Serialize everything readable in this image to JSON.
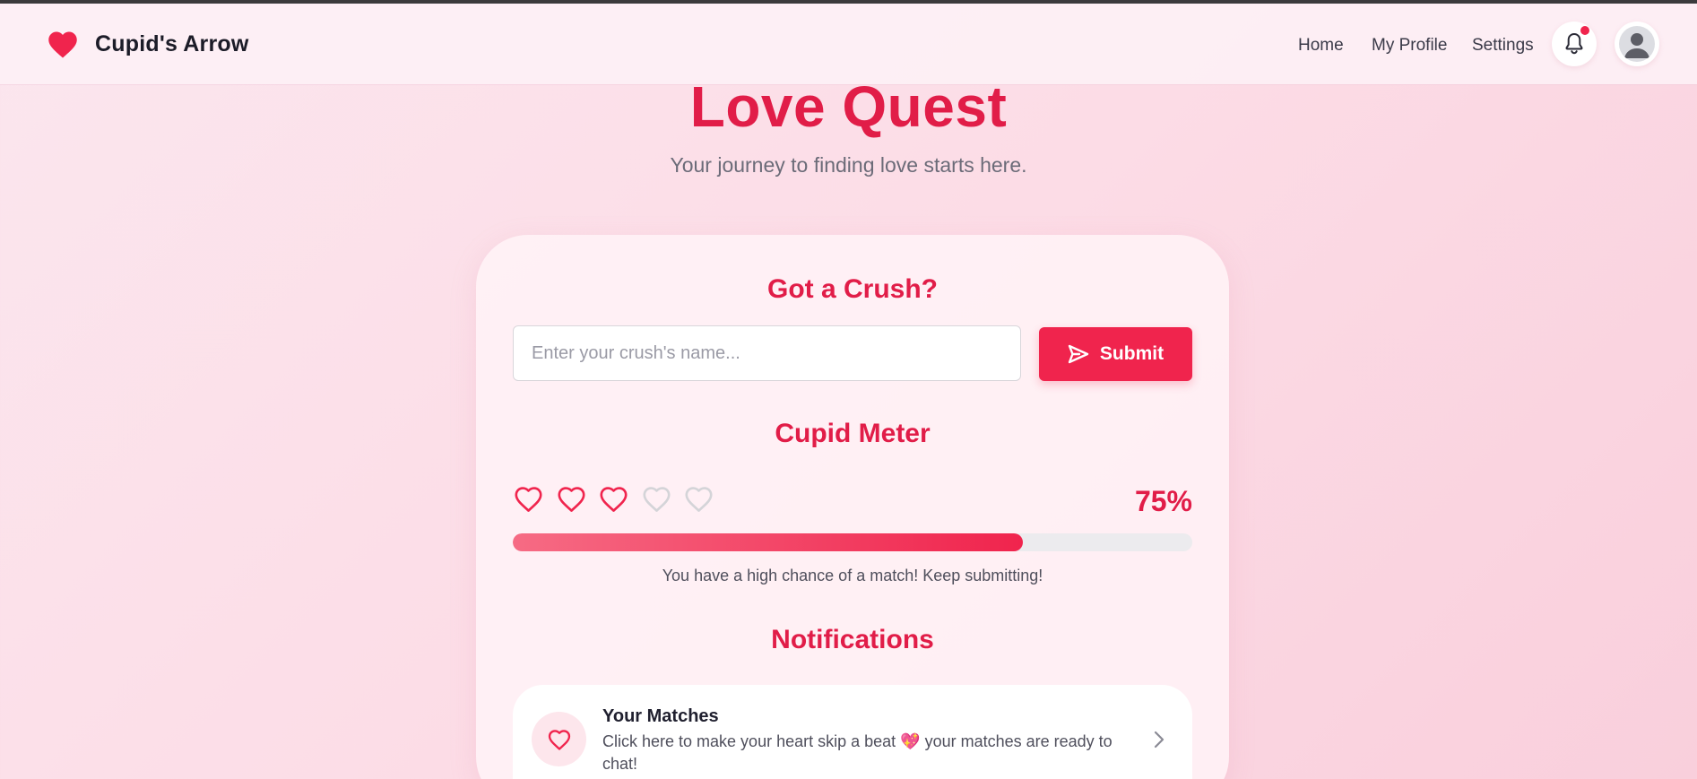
{
  "app": {
    "brand_name": "Cupid's Arrow",
    "brand_icon": "heart-icon"
  },
  "nav": {
    "links": [
      {
        "label": "Home"
      },
      {
        "label": "My Profile"
      },
      {
        "label": "Settings"
      }
    ],
    "bell_icon": "bell-icon",
    "has_unread": true,
    "avatar_icon": "user-avatar-icon"
  },
  "hero": {
    "title": "Love Quest",
    "subtitle": "Your journey to finding love starts here."
  },
  "crush_form": {
    "title": "Got a Crush?",
    "input_placeholder": "Enter your crush's name...",
    "input_value": "",
    "submit_label": "Submit",
    "submit_icon": "send-icon"
  },
  "cupid_meter": {
    "title": "Cupid Meter",
    "hearts_total": 5,
    "hearts_filled": 3,
    "percent_label": "75%",
    "progress_fraction": 0.75,
    "message": "You have a high chance of a match! Keep submitting!"
  },
  "notifications": {
    "title": "Notifications",
    "items": [
      {
        "icon": "heart-icon",
        "title": "Your Matches",
        "body": "Click here to make your heart skip a beat 💖 your matches are ready to chat!",
        "chevron_icon": "chevron-right-icon"
      }
    ]
  },
  "colors": {
    "accent": "#e11d48",
    "button": "#f0244d",
    "heart_empty": "#d4d4d8"
  }
}
